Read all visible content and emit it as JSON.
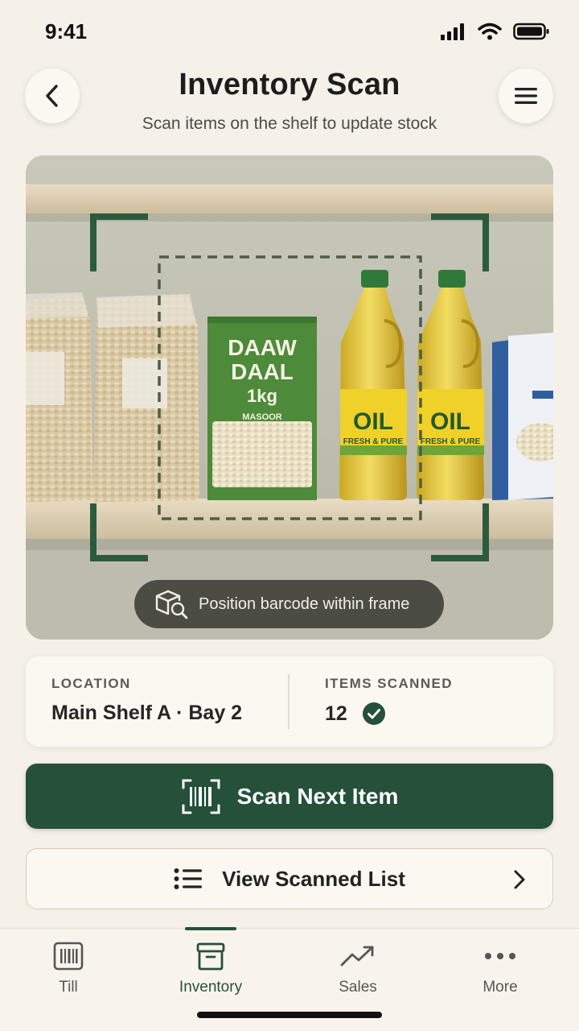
{
  "status_bar": {
    "time": "9:41"
  },
  "header": {
    "title": "Inventory Scan",
    "subtitle": "Scan items on the shelf to update stock"
  },
  "camera": {
    "hint": "Position barcode within frame",
    "products": {
      "daal_brand_line1": "DAAW",
      "daal_brand_line2": "DAAL",
      "daal_weight": "1kg",
      "daal_variety": "MASOOR",
      "oil_name": "OIL",
      "oil_tagline": "FRESH & PURE"
    }
  },
  "info": {
    "location_label": "LOCATION",
    "location_value": "Main Shelf A · Bay 2",
    "items_label": "ITEMS SCANNED",
    "items_value": "12"
  },
  "actions": {
    "primary_label": "Scan Next Item",
    "secondary_label": "View Scanned List"
  },
  "tabs": [
    {
      "label": "Till",
      "icon": "barcode-icon"
    },
    {
      "label": "Inventory",
      "icon": "box-icon",
      "active": true
    },
    {
      "label": "Sales",
      "icon": "trend-icon"
    },
    {
      "label": "More",
      "icon": "more-icon"
    }
  ],
  "colors": {
    "accent": "#25503a",
    "background": "#f6f1e8",
    "card": "#fbf8f2"
  }
}
